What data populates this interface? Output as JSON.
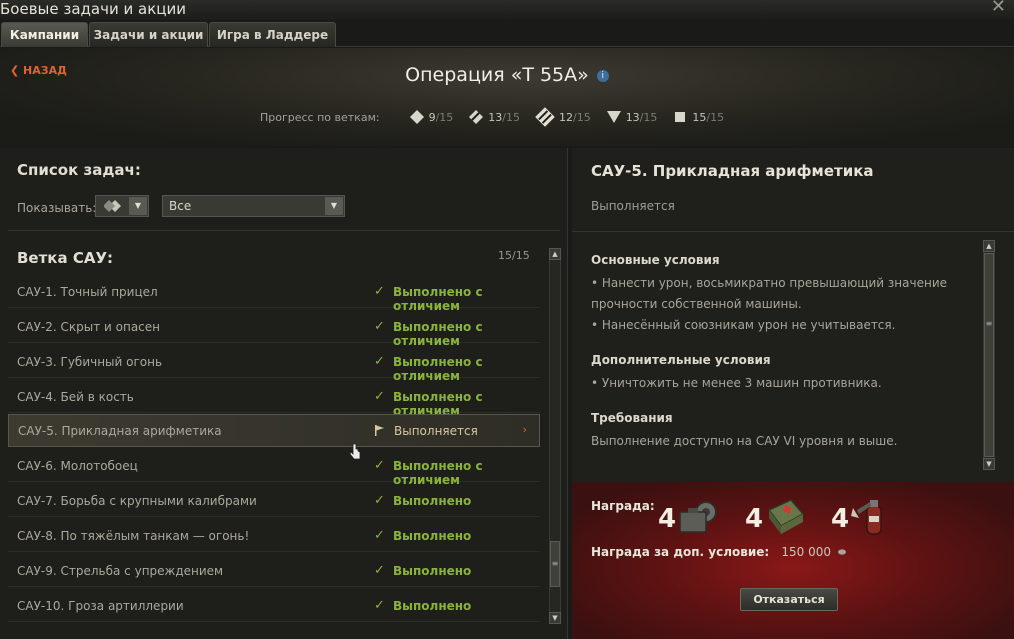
{
  "window": {
    "title": "Боевые задачи и акции",
    "close": "✕"
  },
  "tabs": [
    {
      "label": "Кампании",
      "active": true
    },
    {
      "label": "Задачи и акции",
      "active": false
    },
    {
      "label": "Игра в Ладдере",
      "active": false
    }
  ],
  "header": {
    "back_label": "НАЗАД",
    "operation_title": "Операция «Т 55А»",
    "info_icon": "i",
    "progress_label": "Прогресс по веткам:",
    "branches": [
      {
        "icon": "light-tank-icon",
        "done": "9",
        "total": "/15"
      },
      {
        "icon": "medium-tank-icon",
        "done": "13",
        "total": "/15"
      },
      {
        "icon": "heavy-tank-icon",
        "done": "12",
        "total": "/15"
      },
      {
        "icon": "td-icon",
        "done": "13",
        "total": "/15"
      },
      {
        "icon": "spg-icon",
        "done": "15",
        "total": "/15"
      }
    ]
  },
  "left": {
    "list_title": "Список задач:",
    "show_label": "Показывать:",
    "filter_value": "Все",
    "branch_title": "Ветка САУ:",
    "branch_counter": "15/15",
    "tasks": [
      {
        "name": "САУ-1. Точный прицел",
        "status": "Выполнено с отличием",
        "state": "done"
      },
      {
        "name": "САУ-2. Скрыт и опасен",
        "status": "Выполнено с отличием",
        "state": "done"
      },
      {
        "name": "САУ-3. Губичный огонь",
        "status": "Выполнено с отличием",
        "state": "done"
      },
      {
        "name": "САУ-4. Бей в кость",
        "status": "Выполнено с отличием",
        "state": "done"
      },
      {
        "name": "САУ-5. Прикладная арифметика",
        "status": "Выполняется",
        "state": "active"
      },
      {
        "name": "САУ-6. Молотобоец",
        "status": "Выполнено с отличием",
        "state": "done"
      },
      {
        "name": "САУ-7. Борьба с крупными калибрами",
        "status": "Выполнено",
        "state": "done"
      },
      {
        "name": "САУ-8. По тяжёлым танкам — огонь!",
        "status": "Выполнено",
        "state": "done"
      },
      {
        "name": "САУ-9. Стрельба с упреждением",
        "status": "Выполнено",
        "state": "done"
      },
      {
        "name": "САУ-10. Гроза артиллерии",
        "status": "Выполнено",
        "state": "done"
      }
    ]
  },
  "right": {
    "title": "САУ-5. Прикладная арифметика",
    "status": "Выполняется",
    "main_head": "Основные условия",
    "main_1": "• Нанести урон, восьмикратно превышающий значение прочности собственной машины.",
    "main_2": "• Нанесённый союзникам урон не учитывается.",
    "extra_head": "Дополнительные условия",
    "extra_1": "• Уничтожить не менее 3 машин противника.",
    "req_head": "Требования",
    "req_1": "Выполнение доступно на САУ VI уровня и выше.",
    "reward_label": "Награда:",
    "rewards": [
      {
        "count": "4",
        "icon": "repair-kit-icon"
      },
      {
        "count": "4",
        "icon": "first-aid-kit-icon"
      },
      {
        "count": "4",
        "icon": "fire-extinguisher-icon"
      }
    ],
    "extra_reward_label": "Награда за доп. условие:",
    "extra_reward_value": "150 000",
    "cancel_label": "Отказаться"
  }
}
